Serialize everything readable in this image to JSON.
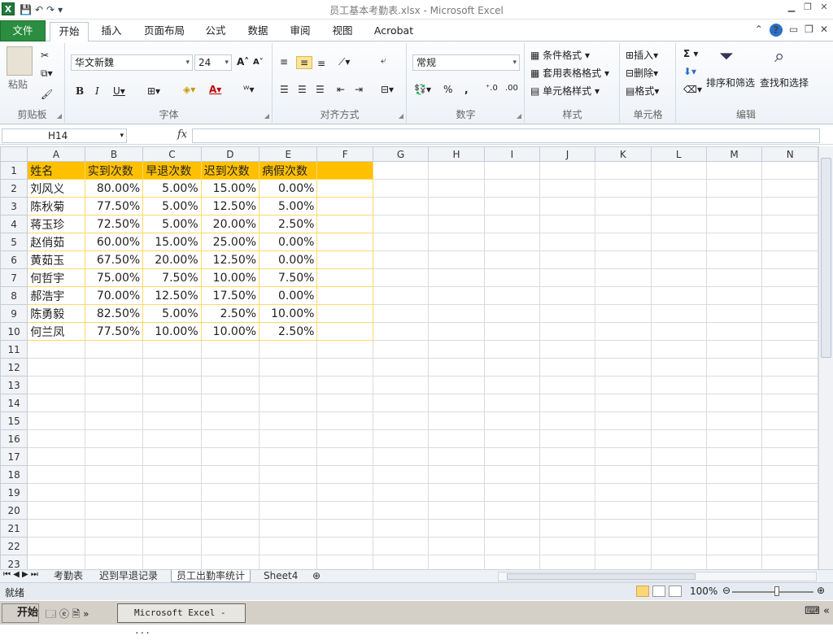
{
  "window": {
    "title": "员工基本考勤表.xlsx  -  Microsoft Excel",
    "app_icon": "X"
  },
  "tabs": [
    {
      "label": "文件"
    },
    {
      "label": "开始"
    },
    {
      "label": "插入"
    },
    {
      "label": "页面布局"
    },
    {
      "label": "公式"
    },
    {
      "label": "数据"
    },
    {
      "label": "审阅"
    },
    {
      "label": "视图"
    },
    {
      "label": "Acrobat"
    }
  ],
  "ribbon": {
    "clipboard": {
      "label": "剪贴板",
      "paste": "粘贴"
    },
    "font": {
      "label": "字体",
      "name": "华文新魏",
      "size": "24"
    },
    "align": {
      "label": "对齐方式"
    },
    "number": {
      "label": "数字",
      "format": "常规"
    },
    "styles": {
      "label": "样式",
      "conditional": "条件格式",
      "table": "套用表格格式",
      "cell": "单元格样式"
    },
    "cells": {
      "label": "单元格",
      "insert": "插入",
      "delete": "删除",
      "format": "格式"
    },
    "editing": {
      "label": "编辑",
      "sort": "排序和筛选",
      "find": "查找和选择"
    }
  },
  "formula_bar": {
    "name_box": "H14",
    "fx": "fx",
    "value": ""
  },
  "columns": [
    "A",
    "B",
    "C",
    "D",
    "E",
    "F",
    "G",
    "H",
    "I",
    "J",
    "K",
    "L",
    "M",
    "N"
  ],
  "rows": [
    [
      "姓名",
      "实到次数",
      "早退次数",
      "迟到次数",
      "病假次数"
    ],
    [
      "刘风义",
      "80.00%",
      "5.00%",
      "15.00%",
      "0.00%"
    ],
    [
      "陈秋菊",
      "77.50%",
      "5.00%",
      "12.50%",
      "5.00%"
    ],
    [
      "蒋玉珍",
      "72.50%",
      "5.00%",
      "20.00%",
      "2.50%"
    ],
    [
      "赵俏茹",
      "60.00%",
      "15.00%",
      "25.00%",
      "0.00%"
    ],
    [
      "黄茹玉",
      "67.50%",
      "20.00%",
      "12.50%",
      "0.00%"
    ],
    [
      "何哲宇",
      "75.00%",
      "7.50%",
      "10.00%",
      "7.50%"
    ],
    [
      "郝浩宇",
      "70.00%",
      "12.50%",
      "17.50%",
      "0.00%"
    ],
    [
      "陈勇毅",
      "82.50%",
      "5.00%",
      "2.50%",
      "10.00%"
    ],
    [
      "何兰凤",
      "77.50%",
      "10.00%",
      "10.00%",
      "2.50%"
    ]
  ],
  "row_numbers": [
    "1",
    "2",
    "3",
    "4",
    "5",
    "6",
    "7",
    "8",
    "9",
    "10",
    "11",
    "12",
    "13",
    "14",
    "15",
    "16",
    "17",
    "18",
    "19",
    "20",
    "21",
    "22",
    "23"
  ],
  "sheet_tabs": [
    {
      "label": "考勤表",
      "active": false
    },
    {
      "label": "迟到早退记录",
      "active": false
    },
    {
      "label": "员工出勤率统计",
      "active": true
    },
    {
      "label": "Sheet4",
      "active": false
    }
  ],
  "status": {
    "ready": "就绪",
    "zoom": "100%"
  },
  "taskbar": {
    "start": "开始",
    "task": "Microsoft Excel - ..."
  },
  "colors": {
    "header_fill": "#ffc000",
    "border": "#ffd966",
    "file_tab": "#2a8d3f"
  }
}
